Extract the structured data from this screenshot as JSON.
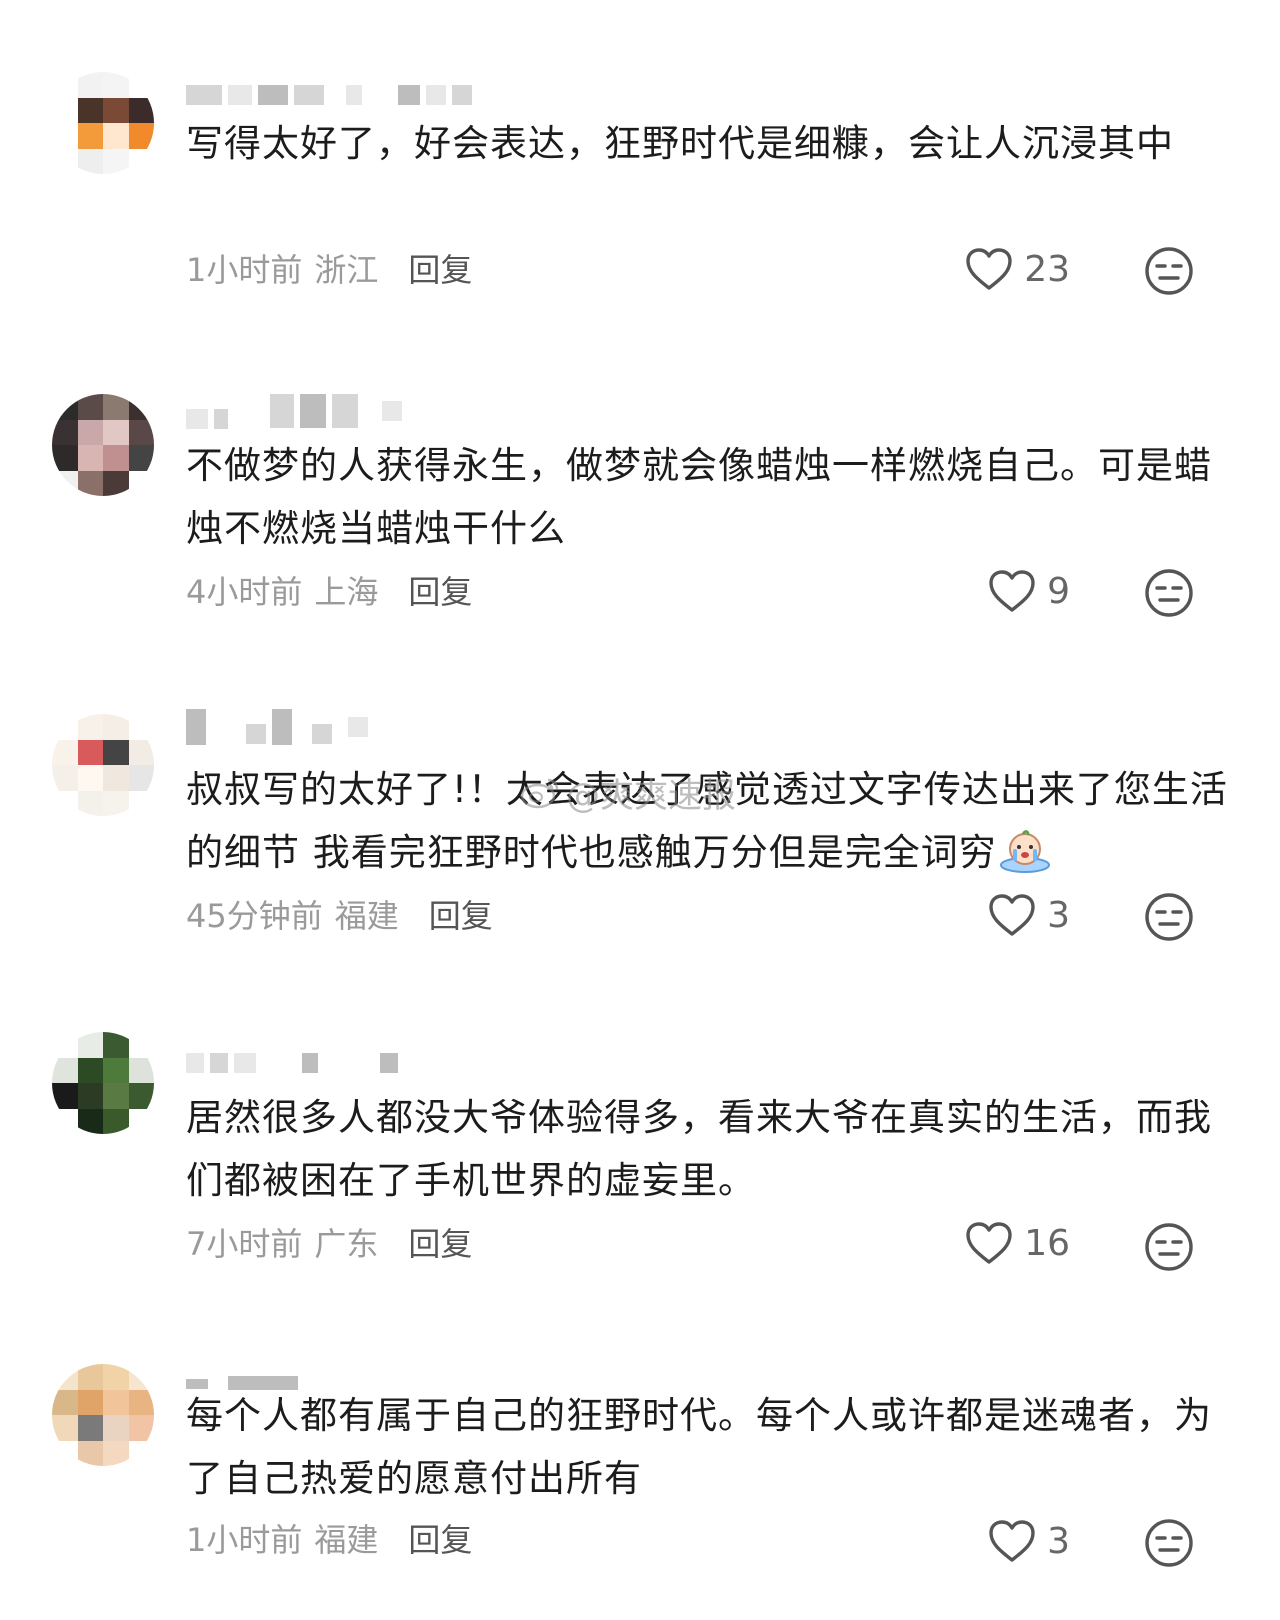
{
  "comments": [
    {
      "text": "写得太好了，好会表达，狂野时代是细糠，会让人沉浸其中",
      "time": "1小时前",
      "location": "浙江",
      "reply": "回复",
      "likes": "23"
    },
    {
      "text": "不做梦的人获得永生，做梦就会像蜡烛一样燃烧自己。可是蜡烛不燃烧当蜡烛干什么",
      "time": "4小时前",
      "location": "上海",
      "reply": "回复",
      "likes": "9"
    },
    {
      "text": "叔叔写的太好了!！太会表达了感觉透过文字传达出来了您生活的细节 我看完狂野时代也感触万分但是完全词穷",
      "time": "45分钟前",
      "location": "福建",
      "reply": "回复",
      "likes": "3"
    },
    {
      "text": "居然很多人都没大爷体验得多，看来大爷在真实的生活，而我们都被困在了手机世界的虚妄里。",
      "time": "7小时前",
      "location": "广东",
      "reply": "回复",
      "likes": "16"
    },
    {
      "text": "每个人都有属于自己的狂野时代。每个人或许都是迷魂者，为了自己热爱的愿意付出所有",
      "time": "1小时前",
      "location": "福建",
      "reply": "回复",
      "likes": "3"
    }
  ],
  "watermark": {
    "text": "@爽爽速报",
    "icon": "weibo-icon"
  },
  "icons": {
    "like": "heart-outline-icon",
    "dislike": "neutral-face-icon",
    "emoji": "crying-emoji-icon"
  },
  "colors": {
    "text": "#1c1c1c",
    "meta": "#9a9a9a",
    "reply": "#555555",
    "icon": "#555555"
  }
}
